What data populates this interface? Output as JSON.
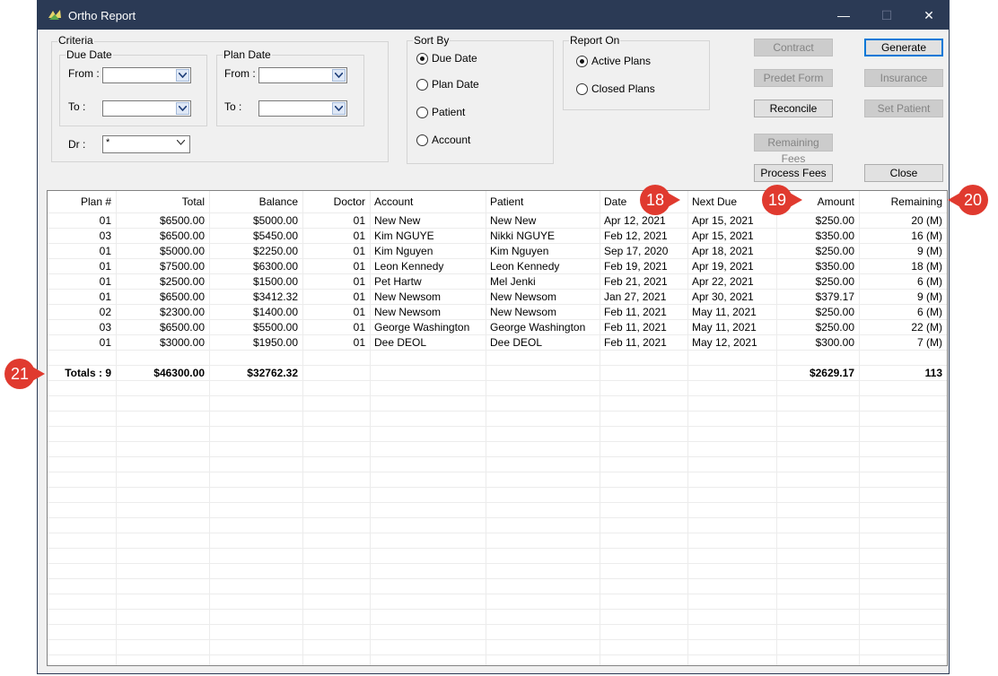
{
  "window": {
    "title": "Ortho Report",
    "controls": {
      "minimize": "—",
      "maximize": "☐",
      "close": "✕"
    }
  },
  "criteria": {
    "label": "Criteria",
    "due_date": {
      "label": "Due Date",
      "from_label": "From :",
      "to_label": "To :"
    },
    "plan_date": {
      "label": "Plan Date",
      "from_label": "From :",
      "to_label": "To :"
    },
    "dr_label": "Dr :",
    "dr_value": "*"
  },
  "sort_by": {
    "label": "Sort By",
    "options": [
      "Due Date",
      "Plan Date",
      "Patient",
      "Account"
    ],
    "selected": "Due Date"
  },
  "report_on": {
    "label": "Report On",
    "options": [
      "Active Plans",
      "Closed Plans"
    ],
    "selected": "Active Plans"
  },
  "buttons": {
    "contract": "Contract",
    "generate": "Generate",
    "predet_form": "Predet Form",
    "insurance": "Insurance",
    "reconcile": "Reconcile",
    "set_patient": "Set Patient",
    "remaining_fees": "Remaining Fees",
    "process_fees": "Process Fees",
    "close": "Close"
  },
  "table": {
    "columns": [
      "Plan #",
      "Total",
      "Balance",
      "Doctor",
      "Account",
      "Patient",
      "Date",
      "Next Due",
      "Amount",
      "Remaining"
    ],
    "rows": [
      [
        "01",
        "$6500.00",
        "$5000.00",
        "01",
        "New New",
        "New New",
        "Apr 12, 2021",
        "Apr 15, 2021",
        "$250.00",
        "20 (M)"
      ],
      [
        "03",
        "$6500.00",
        "$5450.00",
        "01",
        "Kim NGUYE",
        "Nikki NGUYE",
        "Feb 12, 2021",
        "Apr 15, 2021",
        "$350.00",
        "16 (M)"
      ],
      [
        "01",
        "$5000.00",
        "$2250.00",
        "01",
        "Kim Nguyen",
        "Kim Nguyen",
        "Sep 17, 2020",
        "Apr 18, 2021",
        "$250.00",
        "9 (M)"
      ],
      [
        "01",
        "$7500.00",
        "$6300.00",
        "01",
        "Leon Kennedy",
        "Leon Kennedy",
        "Feb 19, 2021",
        "Apr 19, 2021",
        "$350.00",
        "18 (M)"
      ],
      [
        "01",
        "$2500.00",
        "$1500.00",
        "01",
        "Pet Hartw",
        "Mel Jenki",
        "Feb 21, 2021",
        "Apr 22, 2021",
        "$250.00",
        "6 (M)"
      ],
      [
        "01",
        "$6500.00",
        "$3412.32",
        "01",
        "New Newsom",
        "New Newsom",
        "Jan 27, 2021",
        "Apr 30, 2021",
        "$379.17",
        "9 (M)"
      ],
      [
        "02",
        "$2300.00",
        "$1400.00",
        "01",
        "New Newsom",
        "New Newsom",
        "Feb 11, 2021",
        "May 11, 2021",
        "$250.00",
        "6 (M)"
      ],
      [
        "03",
        "$6500.00",
        "$5500.00",
        "01",
        "George Washington",
        "George Washington",
        "Feb 11, 2021",
        "May 11, 2021",
        "$250.00",
        "22 (M)"
      ],
      [
        "01",
        "$3000.00",
        "$1950.00",
        "01",
        "Dee DEOL",
        "Dee DEOL",
        "Feb 11, 2021",
        "May 12, 2021",
        "$300.00",
        "7 (M)"
      ]
    ],
    "totals": {
      "label": "Totals : 9",
      "total": "$46300.00",
      "balance": "$32762.32",
      "amount": "$2629.17",
      "remaining": "113"
    }
  },
  "callouts": [
    "18",
    "19",
    "20",
    "21"
  ],
  "colors": {
    "titlebar": "#2b3a55",
    "callout": "#e03a2f",
    "primary_border": "#0078d7"
  }
}
